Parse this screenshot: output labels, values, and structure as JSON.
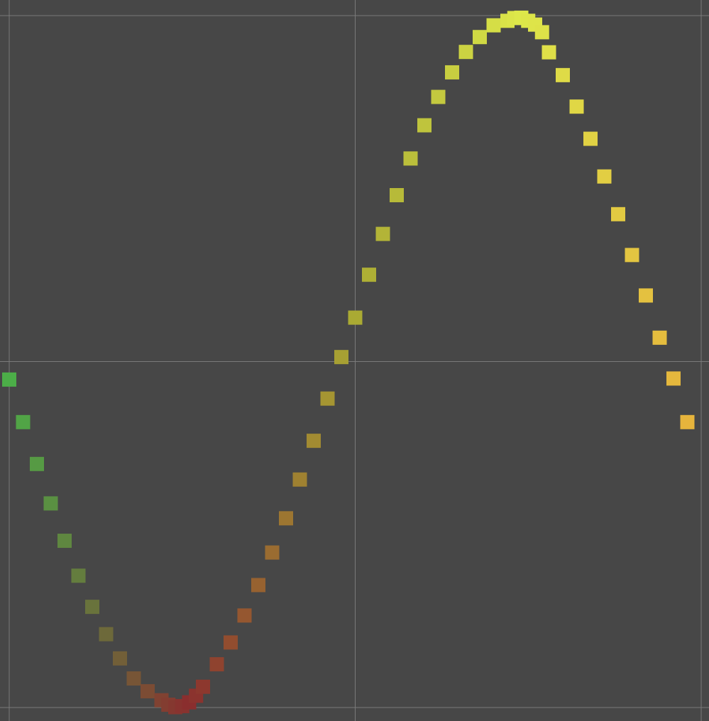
{
  "chart_data": {
    "type": "scatter",
    "title": "",
    "xlabel": "",
    "ylabel": "",
    "grid": true,
    "legend": "none",
    "marker": "square",
    "background_color": "#474747",
    "grid_color": "#7a7a7a",
    "color_scale": {
      "low": "#8a2e2e",
      "mid": "#aaaa33",
      "high": "#dde84a",
      "end": "#e6b43c"
    },
    "xlim": [
      -0.25,
      0.25
    ],
    "ylim": [
      -1,
      1
    ],
    "grid_x": [
      -0.25,
      0,
      0.25
    ],
    "grid_y": [
      -1,
      0,
      1
    ],
    "series": [
      {
        "x": [
          -0.25,
          -0.24,
          -0.23,
          -0.22,
          -0.21,
          -0.2,
          -0.19,
          -0.18,
          -0.17,
          -0.16,
          -0.15,
          -0.14,
          -0.135,
          -0.13,
          -0.125,
          -0.12,
          -0.115,
          -0.11,
          -0.1,
          -0.09,
          -0.08,
          -0.07,
          -0.06,
          -0.05,
          -0.04,
          -0.03,
          -0.02,
          -0.01,
          0,
          0.01,
          0.02,
          0.03,
          0.04,
          0.05,
          0.06,
          0.07,
          0.08,
          0.09,
          0.1,
          0.11,
          0.115,
          0.12,
          0.125,
          0.13,
          0.135,
          0.14,
          0.15,
          0.16,
          0.17,
          0.18,
          0.19,
          0.2,
          0.21,
          0.22,
          0.23,
          0.24
        ],
        "y": [
          -0.052,
          -0.175,
          -0.296,
          -0.41,
          -0.518,
          -0.619,
          -0.709,
          -0.788,
          -0.858,
          -0.916,
          -0.953,
          -0.979,
          -0.992,
          -0.999,
          -0.996,
          -0.985,
          -0.966,
          -0.94,
          -0.875,
          -0.812,
          -0.734,
          -0.646,
          -0.552,
          -0.453,
          -0.341,
          -0.229,
          -0.107,
          0.013,
          0.127,
          0.251,
          0.369,
          0.481,
          0.587,
          0.683,
          0.765,
          0.836,
          0.895,
          0.938,
          0.972,
          0.985,
          0.993,
          0.994,
          0.985,
          0.974,
          0.952,
          0.894,
          0.828,
          0.737,
          0.644,
          0.535,
          0.426,
          0.308,
          0.191,
          0.069,
          -0.049,
          -0.175
        ]
      }
    ]
  }
}
